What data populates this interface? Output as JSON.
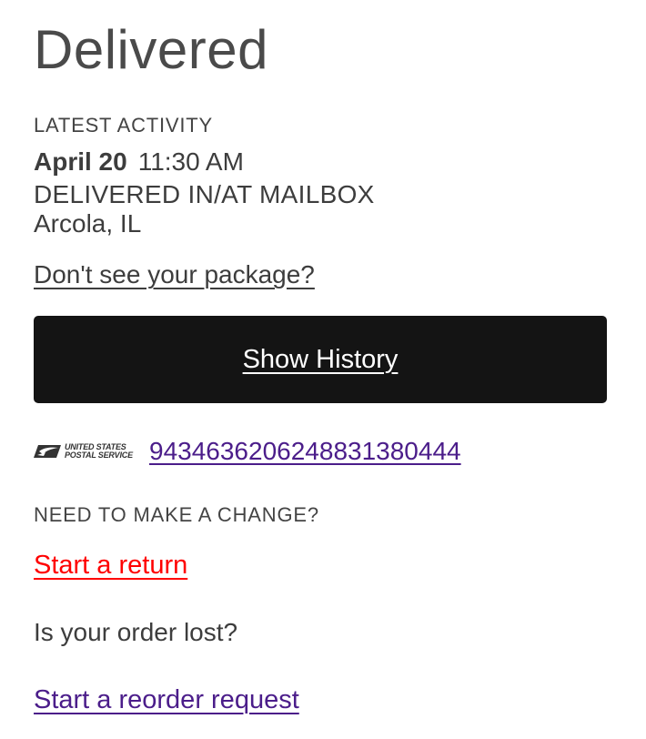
{
  "status": {
    "title": "Delivered"
  },
  "latest_activity": {
    "label": "LATEST ACTIVITY",
    "date": "April 20",
    "time": "11:30 AM",
    "status": "DELIVERED IN/AT MAILBOX",
    "location": "Arcola, IL"
  },
  "missing_package_link": "Don't see your package?",
  "history_button_label": "Show History",
  "carrier": {
    "logo_line1": "UNITED STATES",
    "logo_line2": "POSTAL SERVICE",
    "logo_icon": "usps-eagle-icon",
    "tracking_number": "9434636206248831380444"
  },
  "changes": {
    "label": "NEED TO MAKE A CHANGE?",
    "return_link": "Start a return",
    "lost_question": "Is your order lost?",
    "reorder_link": "Start a reorder request"
  },
  "colors": {
    "button_bg": "#141414",
    "tracking_link": "#4b1d8a",
    "return_link": "#ff0000",
    "reorder_link": "#4b1d8a",
    "text": "#3d3d3d"
  }
}
